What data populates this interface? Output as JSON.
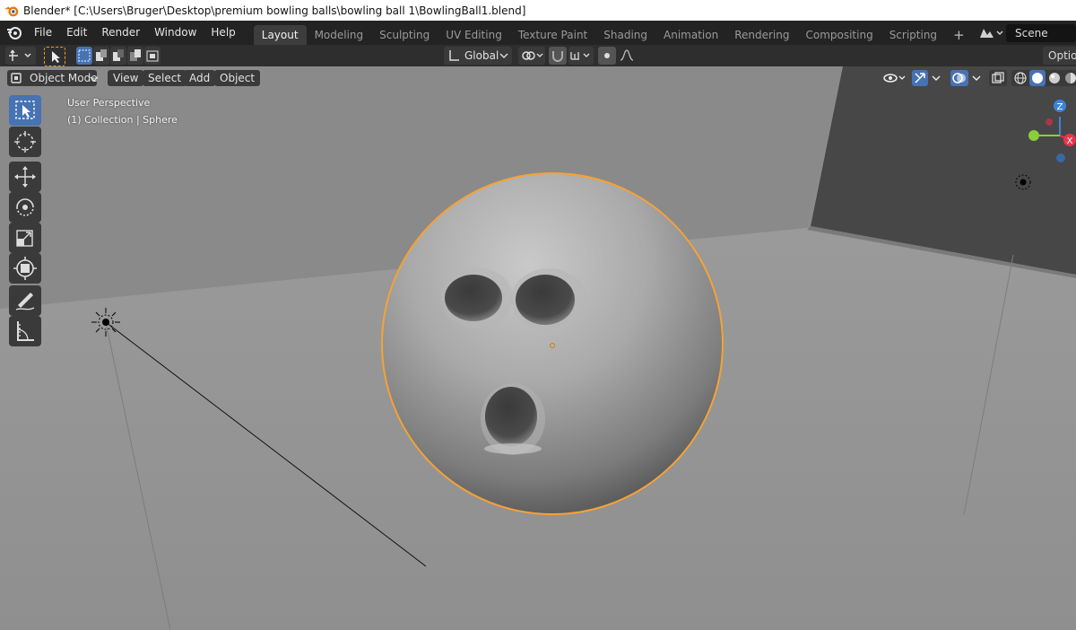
{
  "window": {
    "title": "Blender* [C:\\Users\\Bruger\\Desktop\\premium bowling balls\\bowling ball 1\\BowlingBall1.blend]"
  },
  "menu": [
    "File",
    "Edit",
    "Render",
    "Window",
    "Help"
  ],
  "workspaces": [
    {
      "label": "Layout",
      "active": true
    },
    {
      "label": "Modeling"
    },
    {
      "label": "Sculpting"
    },
    {
      "label": "UV Editing"
    },
    {
      "label": "Texture Paint"
    },
    {
      "label": "Shading"
    },
    {
      "label": "Animation"
    },
    {
      "label": "Rendering"
    },
    {
      "label": "Compositing"
    },
    {
      "label": "Scripting"
    }
  ],
  "scene": {
    "label": "Scene"
  },
  "tool_header": {
    "orientation": "Global",
    "options_label": "Options"
  },
  "viewport_header": {
    "mode": "Object Mode",
    "menus": [
      "View",
      "Select",
      "Add",
      "Object"
    ]
  },
  "viewport_info": {
    "perspective": "User Perspective",
    "collection": "(1) Collection | Sphere"
  },
  "gizmo": {
    "z": "Z",
    "x": "X"
  },
  "toolbar": [
    "select-box",
    "cursor",
    "move",
    "rotate",
    "scale",
    "transform",
    "annotate",
    "measure"
  ],
  "colors": {
    "accent": "#4772b3",
    "selection_outline": "#f5a236",
    "viewport_bg": "#8c8c8c",
    "gizmo_x": "#e8344c",
    "gizmo_y": "#8bcd3a",
    "gizmo_z": "#3b83d8"
  }
}
